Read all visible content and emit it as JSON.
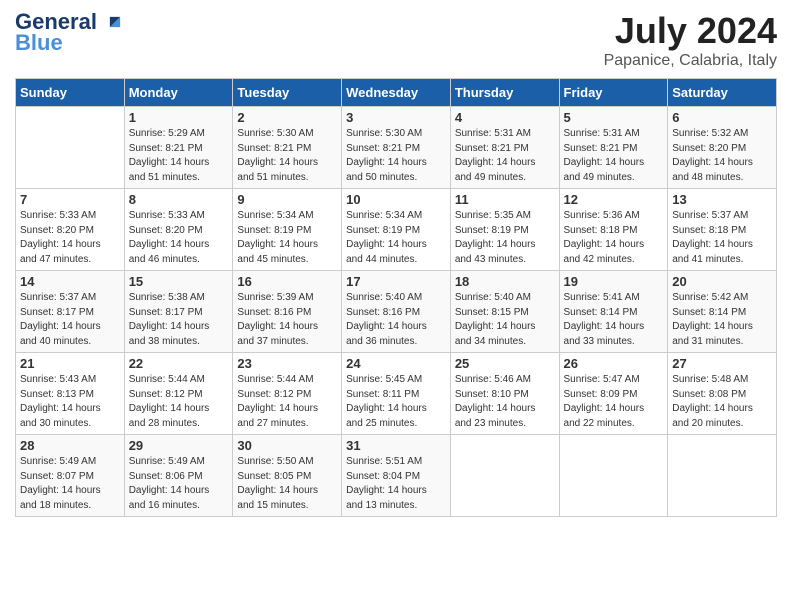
{
  "header": {
    "logo_line1": "General",
    "logo_line2": "Blue",
    "month_title": "July 2024",
    "location": "Papanice, Calabria, Italy"
  },
  "weekdays": [
    "Sunday",
    "Monday",
    "Tuesday",
    "Wednesday",
    "Thursday",
    "Friday",
    "Saturday"
  ],
  "weeks": [
    [
      {
        "day": "",
        "info": ""
      },
      {
        "day": "1",
        "info": "Sunrise: 5:29 AM\nSunset: 8:21 PM\nDaylight: 14 hours\nand 51 minutes."
      },
      {
        "day": "2",
        "info": "Sunrise: 5:30 AM\nSunset: 8:21 PM\nDaylight: 14 hours\nand 51 minutes."
      },
      {
        "day": "3",
        "info": "Sunrise: 5:30 AM\nSunset: 8:21 PM\nDaylight: 14 hours\nand 50 minutes."
      },
      {
        "day": "4",
        "info": "Sunrise: 5:31 AM\nSunset: 8:21 PM\nDaylight: 14 hours\nand 49 minutes."
      },
      {
        "day": "5",
        "info": "Sunrise: 5:31 AM\nSunset: 8:21 PM\nDaylight: 14 hours\nand 49 minutes."
      },
      {
        "day": "6",
        "info": "Sunrise: 5:32 AM\nSunset: 8:20 PM\nDaylight: 14 hours\nand 48 minutes."
      }
    ],
    [
      {
        "day": "7",
        "info": "Sunrise: 5:33 AM\nSunset: 8:20 PM\nDaylight: 14 hours\nand 47 minutes."
      },
      {
        "day": "8",
        "info": "Sunrise: 5:33 AM\nSunset: 8:20 PM\nDaylight: 14 hours\nand 46 minutes."
      },
      {
        "day": "9",
        "info": "Sunrise: 5:34 AM\nSunset: 8:19 PM\nDaylight: 14 hours\nand 45 minutes."
      },
      {
        "day": "10",
        "info": "Sunrise: 5:34 AM\nSunset: 8:19 PM\nDaylight: 14 hours\nand 44 minutes."
      },
      {
        "day": "11",
        "info": "Sunrise: 5:35 AM\nSunset: 8:19 PM\nDaylight: 14 hours\nand 43 minutes."
      },
      {
        "day": "12",
        "info": "Sunrise: 5:36 AM\nSunset: 8:18 PM\nDaylight: 14 hours\nand 42 minutes."
      },
      {
        "day": "13",
        "info": "Sunrise: 5:37 AM\nSunset: 8:18 PM\nDaylight: 14 hours\nand 41 minutes."
      }
    ],
    [
      {
        "day": "14",
        "info": "Sunrise: 5:37 AM\nSunset: 8:17 PM\nDaylight: 14 hours\nand 40 minutes."
      },
      {
        "day": "15",
        "info": "Sunrise: 5:38 AM\nSunset: 8:17 PM\nDaylight: 14 hours\nand 38 minutes."
      },
      {
        "day": "16",
        "info": "Sunrise: 5:39 AM\nSunset: 8:16 PM\nDaylight: 14 hours\nand 37 minutes."
      },
      {
        "day": "17",
        "info": "Sunrise: 5:40 AM\nSunset: 8:16 PM\nDaylight: 14 hours\nand 36 minutes."
      },
      {
        "day": "18",
        "info": "Sunrise: 5:40 AM\nSunset: 8:15 PM\nDaylight: 14 hours\nand 34 minutes."
      },
      {
        "day": "19",
        "info": "Sunrise: 5:41 AM\nSunset: 8:14 PM\nDaylight: 14 hours\nand 33 minutes."
      },
      {
        "day": "20",
        "info": "Sunrise: 5:42 AM\nSunset: 8:14 PM\nDaylight: 14 hours\nand 31 minutes."
      }
    ],
    [
      {
        "day": "21",
        "info": "Sunrise: 5:43 AM\nSunset: 8:13 PM\nDaylight: 14 hours\nand 30 minutes."
      },
      {
        "day": "22",
        "info": "Sunrise: 5:44 AM\nSunset: 8:12 PM\nDaylight: 14 hours\nand 28 minutes."
      },
      {
        "day": "23",
        "info": "Sunrise: 5:44 AM\nSunset: 8:12 PM\nDaylight: 14 hours\nand 27 minutes."
      },
      {
        "day": "24",
        "info": "Sunrise: 5:45 AM\nSunset: 8:11 PM\nDaylight: 14 hours\nand 25 minutes."
      },
      {
        "day": "25",
        "info": "Sunrise: 5:46 AM\nSunset: 8:10 PM\nDaylight: 14 hours\nand 23 minutes."
      },
      {
        "day": "26",
        "info": "Sunrise: 5:47 AM\nSunset: 8:09 PM\nDaylight: 14 hours\nand 22 minutes."
      },
      {
        "day": "27",
        "info": "Sunrise: 5:48 AM\nSunset: 8:08 PM\nDaylight: 14 hours\nand 20 minutes."
      }
    ],
    [
      {
        "day": "28",
        "info": "Sunrise: 5:49 AM\nSunset: 8:07 PM\nDaylight: 14 hours\nand 18 minutes."
      },
      {
        "day": "29",
        "info": "Sunrise: 5:49 AM\nSunset: 8:06 PM\nDaylight: 14 hours\nand 16 minutes."
      },
      {
        "day": "30",
        "info": "Sunrise: 5:50 AM\nSunset: 8:05 PM\nDaylight: 14 hours\nand 15 minutes."
      },
      {
        "day": "31",
        "info": "Sunrise: 5:51 AM\nSunset: 8:04 PM\nDaylight: 14 hours\nand 13 minutes."
      },
      {
        "day": "",
        "info": ""
      },
      {
        "day": "",
        "info": ""
      },
      {
        "day": "",
        "info": ""
      }
    ]
  ]
}
